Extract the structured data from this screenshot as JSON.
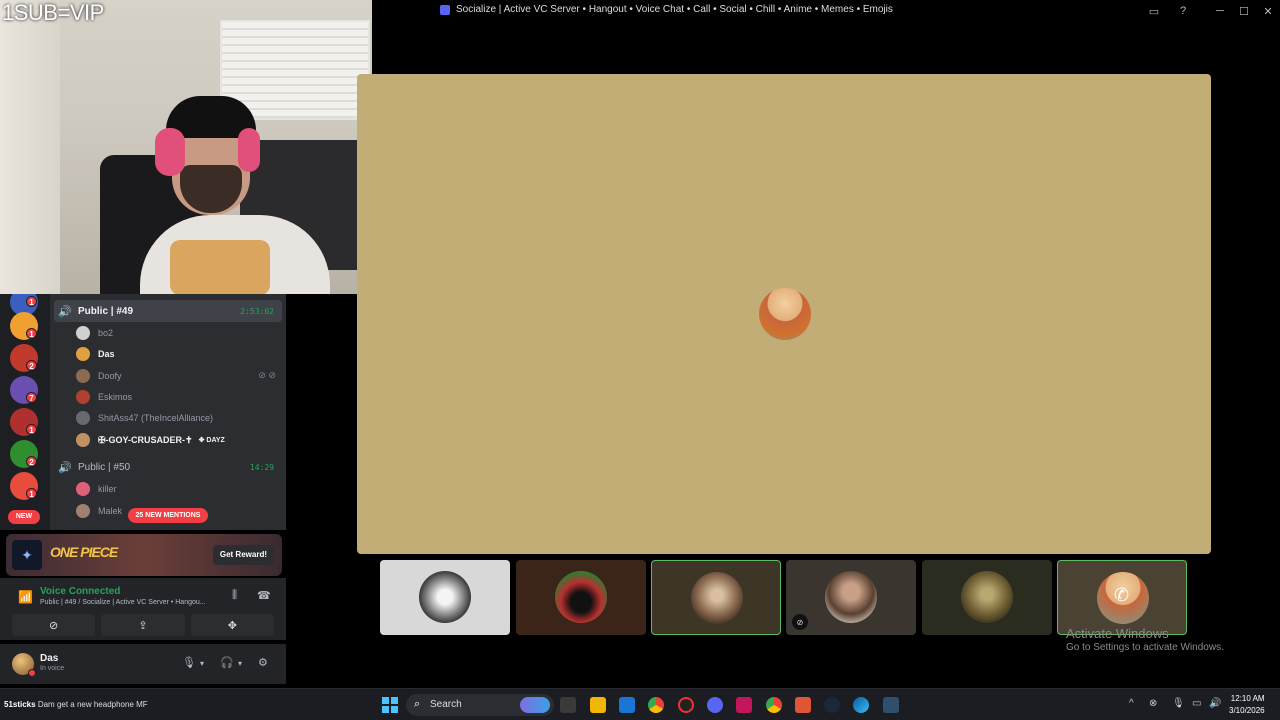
{
  "webcam": {
    "watermark": "1SUB=VIP"
  },
  "window": {
    "title": "Socialize | Active VC Server • Hangout • Voice Chat • Call • Social • Chill • Anime • Memes • Emojis",
    "controls": [
      "minimize",
      "maximize",
      "close"
    ]
  },
  "servers": [
    {
      "name": "server-1",
      "badge": "1",
      "color": "#3b5fbf"
    },
    {
      "name": "server-2",
      "badge": "1",
      "color": "#f0a030"
    },
    {
      "name": "server-3",
      "badge": "2",
      "color": "#c0392b"
    },
    {
      "name": "server-4",
      "badge": "7",
      "color": "#6a4fb0"
    },
    {
      "name": "server-5",
      "badge": "1",
      "color": "#b03030"
    },
    {
      "name": "server-6",
      "badge": "2",
      "color": "#2f8f2f"
    },
    {
      "name": "server-7",
      "badge": "1",
      "color": "#e74c3c"
    }
  ],
  "new_pill": "NEW",
  "channels": {
    "vc1": {
      "name": "Public | #49",
      "duration": "2:53:02"
    },
    "vc1_members": [
      {
        "name": "bo2",
        "color": "#d0d0d0",
        "bright": false
      },
      {
        "name": "Das",
        "color": "#e0a040",
        "bright": true
      },
      {
        "name": "Doofy",
        "color": "#8a6a50",
        "bright": false
      },
      {
        "name": "Eskimos",
        "color": "#b04030",
        "bright": false
      },
      {
        "name": "ShitAss47 (TheIncelAlliance)",
        "color": "#666a70",
        "bright": false
      },
      {
        "name": "✠-GOY-CRUSADER-✝",
        "color": "#c09060",
        "bright": true,
        "tag": "✥ DAYZ"
      }
    ],
    "vc2": {
      "name": "Public | #50",
      "duration": "14:29"
    },
    "vc2_members": [
      {
        "name": "killer",
        "color": "#e0607a"
      },
      {
        "name": "Malek",
        "color": "#a08070"
      }
    ],
    "mentions": "25 NEW MENTIONS"
  },
  "banner": {
    "logo": "ONE PIECE",
    "cta": "Get Reward!"
  },
  "voice": {
    "status": "Voice Connected",
    "location": "Public | #49 / Socialize | Active VC Server • Hangou..."
  },
  "user": {
    "name": "Das",
    "status": "In voice"
  },
  "tiles": [
    {
      "name": "tile-1",
      "bg": "#d8d8d8",
      "avatar": "#5a5a5a",
      "selected": false,
      "muted": false
    },
    {
      "name": "tile-2",
      "bg": "#3b2418",
      "avatar": "#b83030",
      "selected": false,
      "muted": false
    },
    {
      "name": "tile-3",
      "bg": "#3d3526",
      "avatar": "#8c6a50",
      "selected": true,
      "muted": false
    },
    {
      "name": "tile-4",
      "bg": "#3b3530",
      "avatar": "#d8c8b8",
      "selected": false,
      "muted": true
    },
    {
      "name": "tile-5",
      "bg": "#2a2c20",
      "avatar": "#8a7a40",
      "selected": false,
      "muted": false
    },
    {
      "name": "tile-6",
      "bg": "#4a4232",
      "avatar": "#c8663b",
      "selected": true,
      "muted": false
    }
  ],
  "activate": {
    "line1": "Activate Windows",
    "line2": "Go to Settings to activate Windows."
  },
  "taskbar": {
    "ticker_user": "51sticks",
    "ticker_msg": "Dam get a new headphone MF",
    "search": "Search",
    "time": "12:10 AM",
    "date": "3/10/2026"
  }
}
